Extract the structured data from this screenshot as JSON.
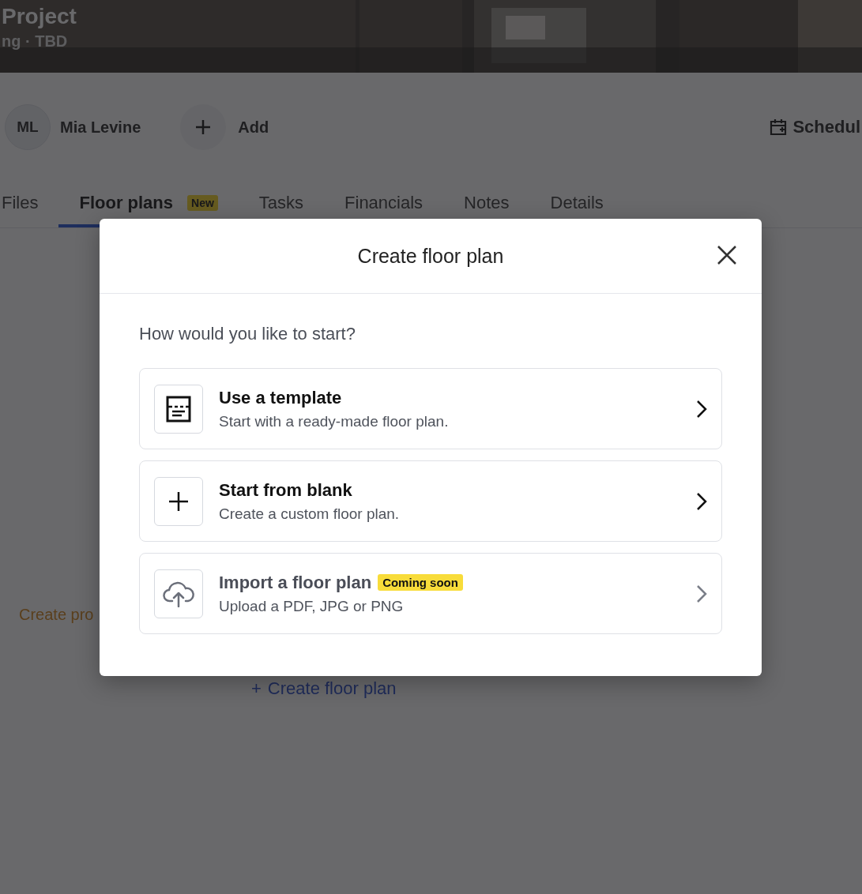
{
  "project": {
    "title": "Project",
    "subtitle": "ng · TBD"
  },
  "people": {
    "avatar": "ML",
    "name": "Mia Levine",
    "add_label": "Add",
    "schedule_label": "Schedul"
  },
  "tabs": [
    {
      "label": "Files",
      "selected": false
    },
    {
      "label": "Floor plans",
      "selected": true,
      "badge": "New"
    },
    {
      "label": "Tasks",
      "selected": false
    },
    {
      "label": "Financials",
      "selected": false
    },
    {
      "label": "Notes",
      "selected": false
    },
    {
      "label": "Details",
      "selected": false
    }
  ],
  "background": {
    "create_project_link": "Create pro",
    "create_floor_plan_link": "Create floor plan",
    "plus": "+"
  },
  "dialog": {
    "title": "Create floor plan",
    "prompt": "How would you like to start?",
    "options": [
      {
        "kind": "template",
        "title": "Use a template",
        "subtitle": "Start with a ready-made floor plan.",
        "disabled": false
      },
      {
        "kind": "blank",
        "title": "Start from blank",
        "subtitle": "Create a custom floor plan.",
        "disabled": false
      },
      {
        "kind": "upload",
        "title": "Import a floor plan",
        "badge": "Coming soon",
        "subtitle": "Upload a PDF, JPG or PNG",
        "disabled": true
      }
    ]
  }
}
